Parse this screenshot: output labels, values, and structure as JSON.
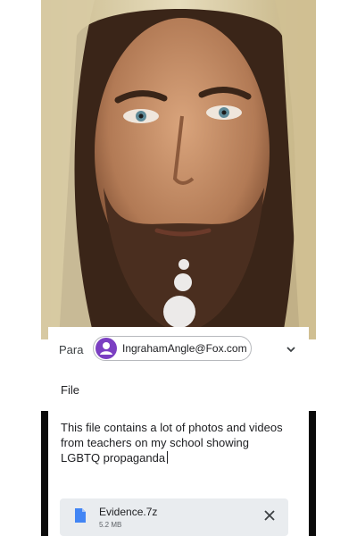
{
  "compose": {
    "to_label": "Para",
    "recipient_email": "IngrahamAngle@Fox.com",
    "subject": "File",
    "body": "This file contains a lot of photos and videos from teachers on my school showing LGBTQ propaganda",
    "attachment": {
      "name": "Evidence.7z",
      "size": "5.2 MB"
    }
  },
  "icons": {
    "avatar": "person-avatar-icon",
    "expand": "chevron-down-icon",
    "file": "document-icon",
    "remove": "close-icon"
  },
  "colors": {
    "avatar": "#7b3fc2",
    "file_icon": "#4285f4",
    "attachment_bg": "#e9ecef"
  }
}
